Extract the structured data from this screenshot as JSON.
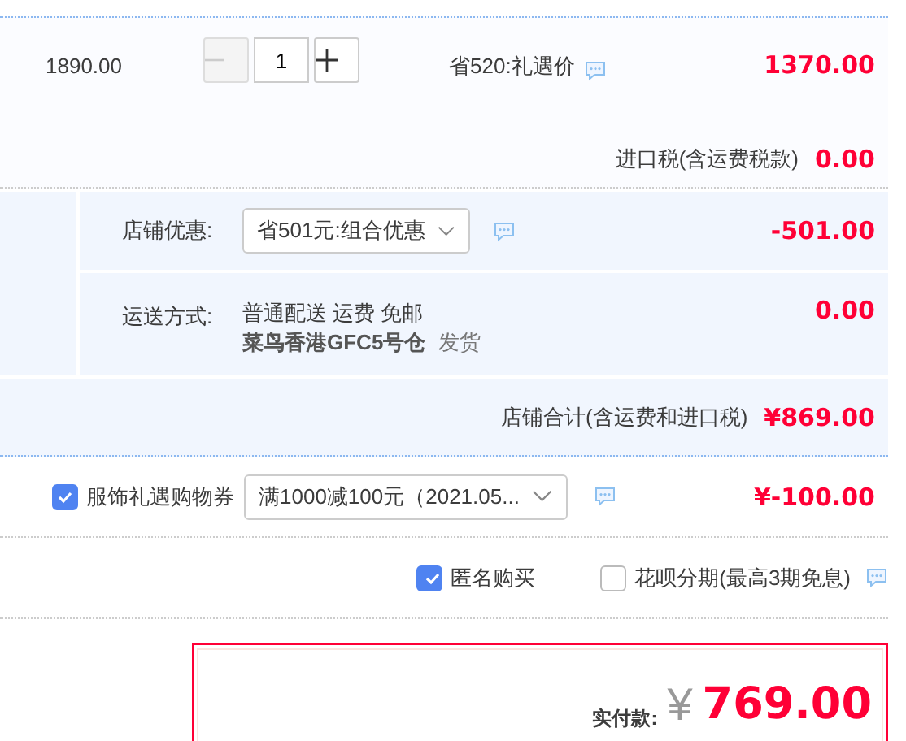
{
  "item": {
    "unit_price": "1890.00",
    "quantity": "1",
    "minus_disabled": true,
    "promo": "省520:礼遇价",
    "subtotal": "1370.00",
    "tax_label": "进口税(含运费税款)",
    "tax": "0.00"
  },
  "shop": {
    "discount_label": "店铺优惠:",
    "discount_choice": "省501元:组合优惠",
    "discount": "-501.00",
    "shipping_label": "运送方式:",
    "shipping_method": "普通配送 运费 免邮",
    "warehouse": "菜鸟香港GFC5号仓",
    "dispatch": "发货",
    "shipping": "0.00",
    "total_label": "店铺合计(含运费和进口税)",
    "total": "¥869.00"
  },
  "coupon": {
    "checked": true,
    "label": "服饰礼遇购物券",
    "choice": "满1000减100元（2021.05...",
    "amount": "¥-100.00"
  },
  "options": [
    {
      "label": "匿名购买",
      "checked": true,
      "has_info": false
    },
    {
      "label": "花呗分期(最高3期免息)",
      "checked": false,
      "has_info": true
    }
  ],
  "payment": {
    "label": "实付款:",
    "currency": "¥",
    "amount": "769.00"
  }
}
